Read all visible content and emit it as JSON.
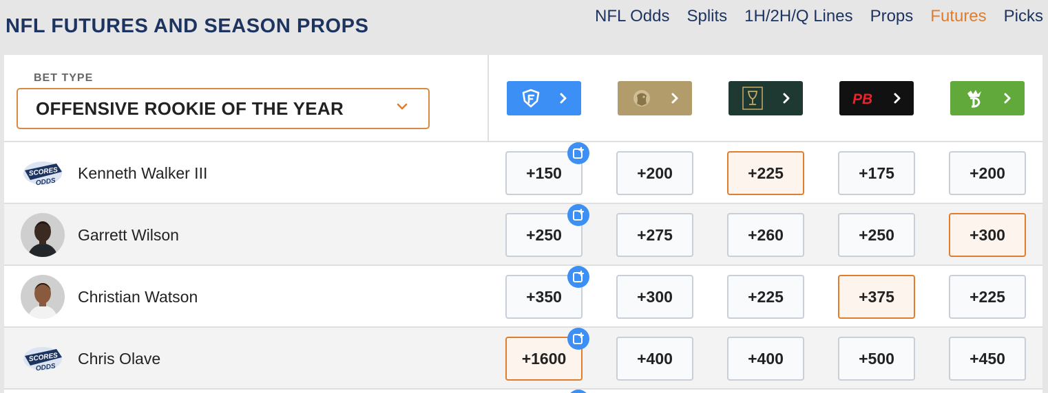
{
  "header": {
    "title": "NFL FUTURES AND SEASON PROPS",
    "nav": [
      "NFL Odds",
      "Splits",
      "1H/2H/Q Lines",
      "Props",
      "Futures",
      "Picks"
    ],
    "active_nav": "Futures"
  },
  "bet_type": {
    "label": "BET TYPE",
    "selected": "OFFENSIVE ROOKIE OF THE YEAR"
  },
  "sportsbooks": [
    {
      "icon": "fanduel-logo-icon",
      "color": "#3b8ff5"
    },
    {
      "icon": "betmgm-lion-logo-icon",
      "color": "#b29c6c"
    },
    {
      "icon": "caesars-chalice-logo-icon",
      "color": "#1e3832"
    },
    {
      "icon": "pointsbet-logo-icon",
      "color": "#111111",
      "logo_text": "PB"
    },
    {
      "icon": "draftkings-crown-logo-icon",
      "color": "#61a93b"
    }
  ],
  "players": [
    {
      "name": "Kenneth Walker III",
      "avatar": "scores-and-odds-logo-icon",
      "odds": [
        "+150",
        "+200",
        "+225",
        "+175",
        "+200"
      ],
      "best": 2
    },
    {
      "name": "Garrett Wilson",
      "avatar": "player-headshot",
      "odds": [
        "+250",
        "+275",
        "+260",
        "+250",
        "+300"
      ],
      "best": 4
    },
    {
      "name": "Christian Watson",
      "avatar": "player-headshot",
      "odds": [
        "+350",
        "+300",
        "+225",
        "+375",
        "+225"
      ],
      "best": 3
    },
    {
      "name": "Chris Olave",
      "avatar": "scores-and-odds-logo-icon",
      "odds": [
        "+1600",
        "+400",
        "+400",
        "+500",
        "+450"
      ],
      "best": 0
    }
  ],
  "colors": {
    "accent": "#e07d2d",
    "navy": "#1d3461",
    "add_button": "#3b8ff5"
  }
}
